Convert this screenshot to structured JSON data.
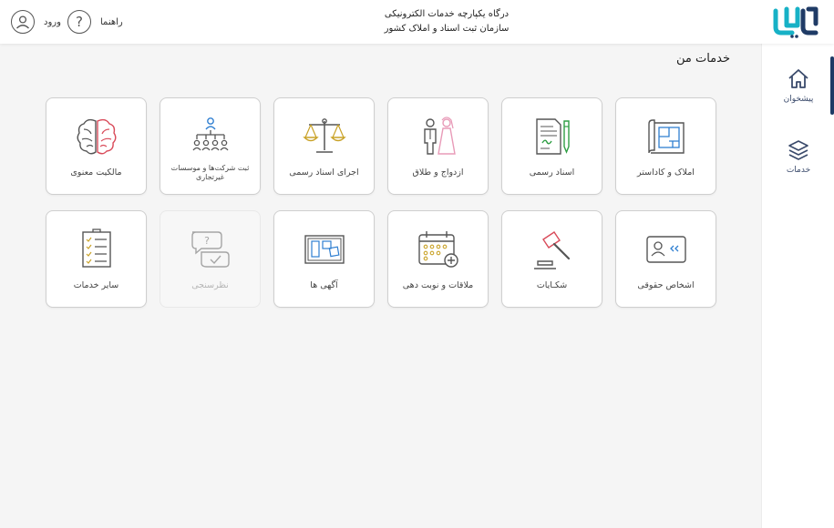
{
  "header": {
    "title_line1": "درگاه یکپارچه خدمات الکترونیکی",
    "title_line2": "سازمان ثبت اسناد و املاک کشور",
    "help_label": "راهنما",
    "login_label": "ورود",
    "help_icon_glyph": "?"
  },
  "sidebar": {
    "items": [
      {
        "label": "پیشخوان",
        "icon": "home-icon",
        "active": true
      },
      {
        "label": "خدمات",
        "icon": "layers-icon",
        "active": false
      }
    ]
  },
  "main": {
    "title": "خدمات من",
    "tiles": [
      {
        "label": "املاک و کاداستر",
        "icon": "blueprint-icon",
        "enabled": true
      },
      {
        "label": "اسناد رسمی",
        "icon": "document-pen-icon",
        "enabled": true
      },
      {
        "label": "ازدواج و طلاق",
        "icon": "couple-icon",
        "enabled": true
      },
      {
        "label": "اجرای اسناد رسمی",
        "icon": "scales-icon",
        "enabled": true
      },
      {
        "label": "ثبت شرکت‌ها و موسسات غیرتجاری",
        "icon": "org-chart-icon",
        "enabled": true
      },
      {
        "label": "مالکیت معنوی",
        "icon": "brain-icon",
        "enabled": true
      },
      {
        "label": "اشخاص حقوقی",
        "icon": "id-card-icon",
        "enabled": true
      },
      {
        "label": "شکـایات",
        "icon": "gavel-icon",
        "enabled": true
      },
      {
        "label": "ملاقات و نوبت دهی",
        "icon": "calendar-add-icon",
        "enabled": true
      },
      {
        "label": "آگهی ها",
        "icon": "bulletin-board-icon",
        "enabled": true
      },
      {
        "label": "نظرسنجی",
        "icon": "chat-survey-icon",
        "enabled": false
      },
      {
        "label": "سایر خدمات",
        "icon": "checklist-icon",
        "enabled": true
      }
    ]
  },
  "colors": {
    "brand_teal": "#17b1c6",
    "brand_navy": "#1f3b66",
    "icon_green": "#2f9e44",
    "icon_red": "#d94b5a",
    "icon_gold": "#c9a227",
    "icon_pink": "#e89bb8",
    "icon_blue": "#2f7fd1"
  }
}
